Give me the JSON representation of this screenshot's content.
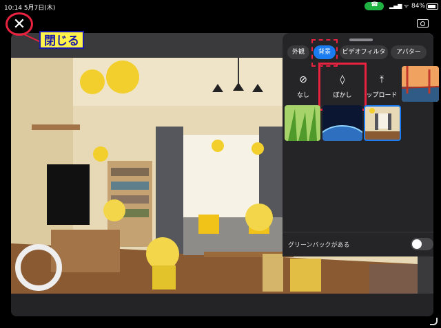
{
  "status_bar": {
    "time": "10:14",
    "date": "5月7日(木)",
    "battery": "84%"
  },
  "toolbar": {
    "close_glyph": "✕",
    "close_annotation": "閉じる"
  },
  "background_panel": {
    "tabs": [
      {
        "label": "外観"
      },
      {
        "label": "背景",
        "active": true
      },
      {
        "label": "ビデオフィルタ"
      },
      {
        "label": "アバター"
      }
    ],
    "options": [
      {
        "label": "なし",
        "icon": "none-icon",
        "glyph": "⊘"
      },
      {
        "label": "ぼかし",
        "icon": "blur-drop-icon",
        "glyph": "◊"
      },
      {
        "label": "ップロード",
        "icon": "upload-icon",
        "glyph": "⤒"
      }
    ],
    "thumbnails": [
      "golden-gate-bridge",
      "green-grass",
      "earth-from-space",
      "living-room"
    ],
    "selected_thumbnail": "living-room",
    "green_screen": {
      "label": "グリーンバックがある",
      "enabled": false
    }
  },
  "colors": {
    "accent": "#1a7cf0",
    "highlight": "#e9233f",
    "annotation_bg": "#fff24a",
    "panel_bg": "#252527"
  }
}
